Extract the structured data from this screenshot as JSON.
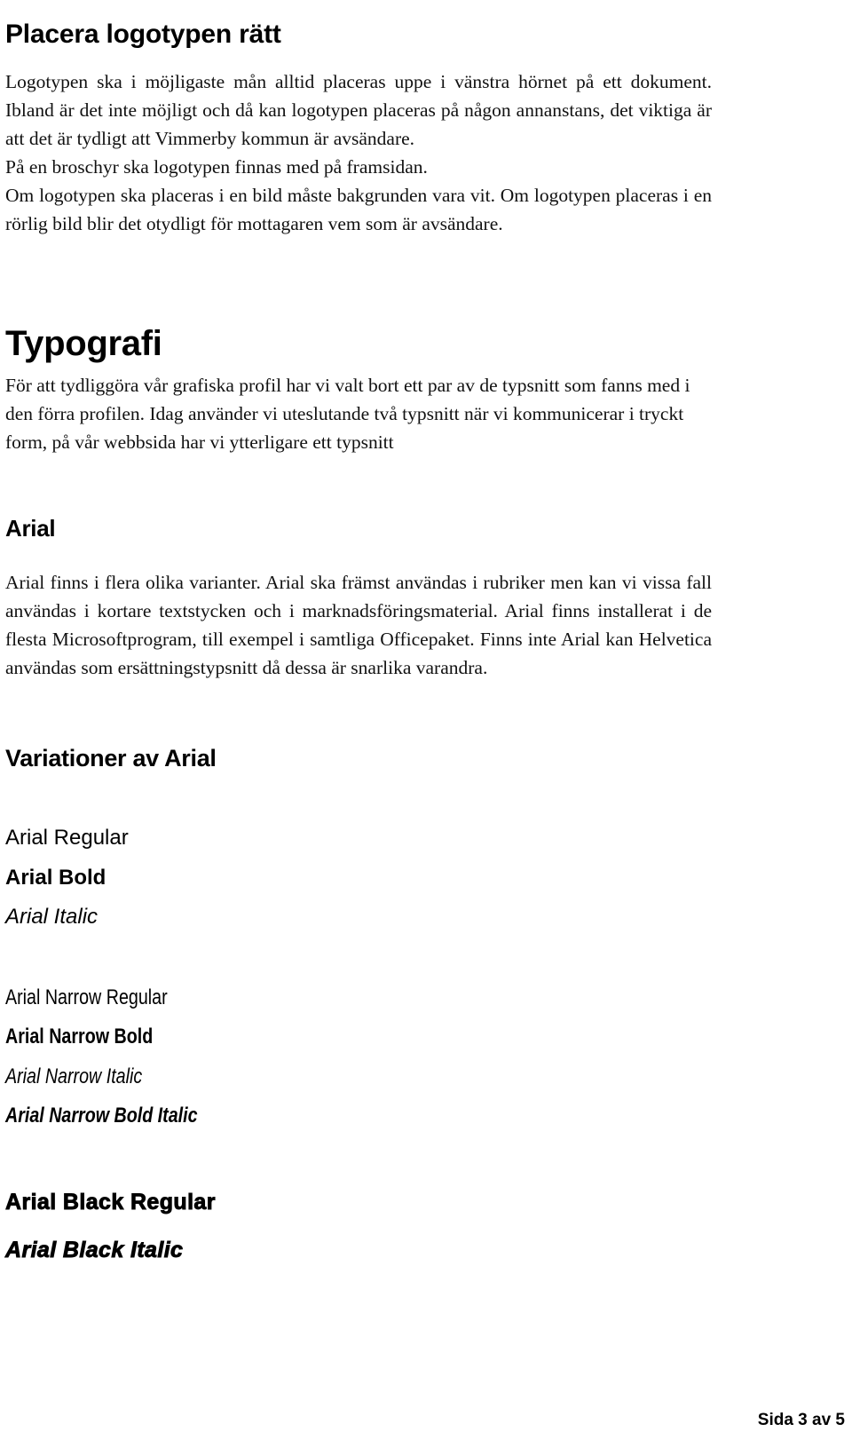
{
  "document": {
    "language": "sv",
    "page_background": "#ffffff",
    "text_color": "#000000"
  },
  "sections": {
    "logo_placement": {
      "heading": "Placera logotypen rätt",
      "paragraphs": [
        "Logotypen ska i möjligaste mån alltid placeras uppe i vänstra hörnet på ett dokument. Ibland är det inte möjligt och då kan logotypen placeras på någon annanstans, det viktiga är att det är tydligt att Vimmerby kommun är avsändare.",
        "På en broschyr ska logotypen finnas med på framsidan.",
        "Om logotypen ska placeras i en bild måste bakgrunden vara vit. Om logotypen placeras i en rörlig bild blir det otydligt för mottagaren vem som är avsändare."
      ]
    },
    "typografi": {
      "heading": "Typografi",
      "paragraph": "För att tydliggöra vår grafiska profil har vi valt bort ett par av de typsnitt som fanns med i den förra profilen. Idag använder vi uteslutande två typsnitt när vi kommunicerar i tryckt form, på vår webbsida har vi ytterligare ett typsnitt"
    },
    "arial": {
      "heading": "Arial",
      "paragraph": "Arial finns i flera olika varianter. Arial ska främst användas i rubriker men kan vi vissa fall användas i kortare textstycken och i marknadsföringsmaterial. Arial finns installerat i de flesta Microsoftprogram, till exempel i samtliga Officepaket. Finns inte Arial kan Helvetica användas som ersättningstypsnitt då dessa är snarlika varandra."
    },
    "variationer": {
      "heading": "Variationer av Arial",
      "specimens": [
        {
          "label": "Arial Regular",
          "style": "regular"
        },
        {
          "label": "Arial Bold",
          "style": "bold"
        },
        {
          "label": "Arial Italic",
          "style": "italic"
        },
        {
          "label": "Arial Narrow Regular",
          "style": "narrow-regular"
        },
        {
          "label": "Arial Narrow Bold",
          "style": "narrow-bold"
        },
        {
          "label": "Arial Narrow Italic",
          "style": "narrow-italic"
        },
        {
          "label": "Arial Narrow Bold Italic",
          "style": "narrow-bold-italic"
        },
        {
          "label": "Arial Black Regular",
          "style": "black-regular"
        },
        {
          "label": "Arial Black Italic",
          "style": "black-italic"
        }
      ]
    }
  },
  "footer": {
    "page_label": "Sida 3 av 5",
    "current_page": 3,
    "total_pages": 5
  }
}
